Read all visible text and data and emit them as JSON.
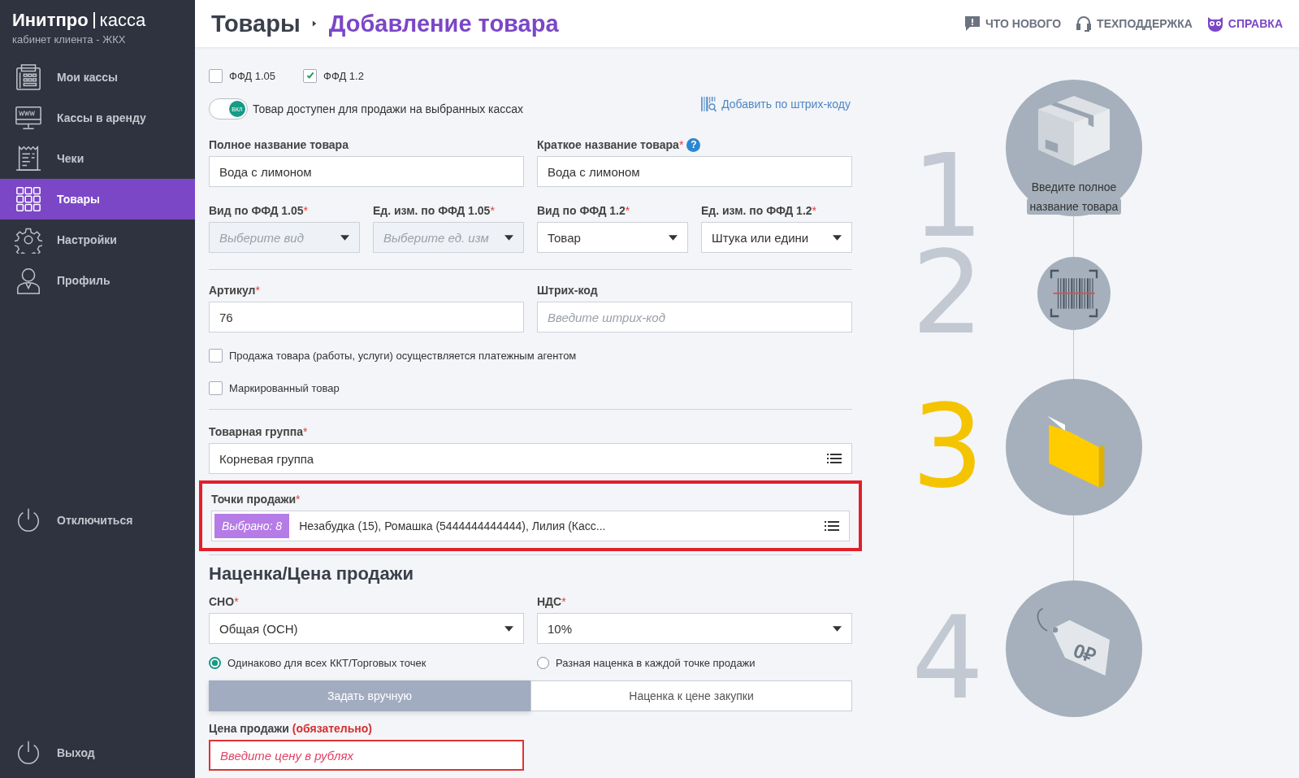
{
  "sidebar": {
    "brand": "Инитпро",
    "brand_suffix": "касса",
    "subtitle": "кабинет клиента - ЖКХ",
    "items": [
      {
        "label": "Мои кассы",
        "selected": false
      },
      {
        "label": "Кассы в аренду",
        "selected": false
      },
      {
        "label": "Чеки",
        "selected": false
      },
      {
        "label": "Товары",
        "selected": true
      },
      {
        "label": "Настройки",
        "selected": false
      },
      {
        "label": "Профиль",
        "selected": false
      }
    ],
    "bottom_items": [
      "Отключиться",
      "Выход"
    ]
  },
  "header": {
    "breadcrumb": [
      "Товары",
      "Добавление товара"
    ],
    "links": [
      {
        "label": "ЧТО НОВОГО",
        "accent": false
      },
      {
        "label": "ТЕХПОДДЕРЖКА",
        "accent": false
      },
      {
        "label": "СПРАВКА",
        "accent": true
      }
    ]
  },
  "form": {
    "ffd": [
      {
        "label": "ФФД 1.05",
        "checked": false
      },
      {
        "label": "ФФД 1.2",
        "checked": true
      }
    ],
    "toggle": {
      "on": true,
      "badge": "ВКЛ",
      "label": "Товар доступен для продажи на выбранных кассах"
    },
    "barcode_link": "Добавить по штрих-коду",
    "name_fields": [
      {
        "label": "Полное название товара",
        "value": "Вода с лимоном"
      },
      {
        "label": "Краткое название товара",
        "asterisk": "*",
        "help": "?",
        "value": "Вода с лимоном"
      }
    ],
    "ffd_selects": [
      {
        "label": "Вид по ФФД 1.05",
        "asterisk": "*",
        "placeholder": "Выберите вид",
        "disabled": true
      },
      {
        "label": "Ед. изм. по ФФД 1.05",
        "asterisk": "*",
        "placeholder": "Выберите ед. изм",
        "disabled": true
      },
      {
        "label": "Вид по ФФД 1.2",
        "asterisk": "*",
        "value": "Товар",
        "disabled": false
      },
      {
        "label": "Ед. изм. по ФФД 1.2",
        "asterisk": "*",
        "value": "Штука или едини",
        "disabled": false
      }
    ],
    "code_fields": [
      {
        "label": "Артикул",
        "asterisk": "*",
        "value": "76"
      },
      {
        "label": "Штрих-код",
        "placeholder": "Введите штрих-код"
      }
    ],
    "options": [
      {
        "label": "Продажа товара (работы, услуги) осуществляется платежным агентом",
        "checked": false
      },
      {
        "label": "Маркированный товар",
        "checked": false
      }
    ],
    "group": {
      "label": "Товарная группа",
      "asterisk": "*",
      "value": "Корневая группа"
    },
    "points": {
      "label": "Точки продажи",
      "asterisk": "*",
      "badge": "Выбрано: 8",
      "value": "Незабудка (15), Ромашка (5444444444444), Лилия (Касс...",
      "highlighted": true
    }
  },
  "pricing": {
    "title": "Наценка/Цена продажи",
    "selects": [
      {
        "label": "СНО",
        "asterisk": "*",
        "value": "Общая (ОСН)"
      },
      {
        "label": "НДС",
        "asterisk": "*",
        "value": "10%"
      }
    ],
    "radios": [
      {
        "label": "Одинаково для всех ККТ/Торговых точек",
        "selected": true
      },
      {
        "label": "Разная наценка в каждой точке продажи",
        "selected": false
      }
    ],
    "modes": [
      {
        "label": "Задать вручную",
        "selected": true
      },
      {
        "label": "Наценка к цене закупки",
        "selected": false
      }
    ],
    "price": {
      "label": "Цена продажи",
      "note": "(обязательно)",
      "placeholder": "Введите цену в рублях",
      "invalid": true
    }
  },
  "steps": [
    {
      "number": "1",
      "caption": "Введите полное название товара",
      "active": false
    },
    {
      "number": "2",
      "active": false
    },
    {
      "number": "3",
      "active": true
    },
    {
      "number": "4",
      "tag_text": "0₽",
      "active": false
    }
  ]
}
